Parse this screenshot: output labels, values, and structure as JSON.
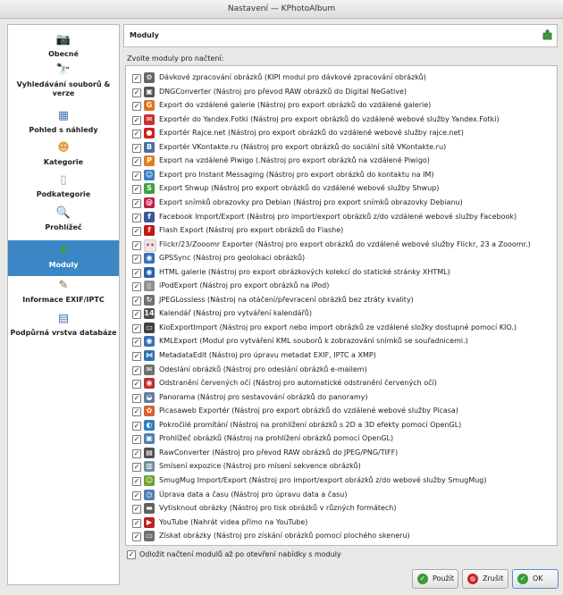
{
  "window": {
    "title": "Nastavení — KPhotoAlbum"
  },
  "sidebar": {
    "items": [
      {
        "label": "Obecné",
        "icon": "camera-icon",
        "glyph": "📷",
        "color": "#444444"
      },
      {
        "label": "Vyhledávání souborů & verze",
        "icon": "binoculars-icon",
        "glyph": "🔭",
        "color": "#555555"
      },
      {
        "label": "Pohled s náhledy",
        "icon": "thumbnails-icon",
        "glyph": "▦",
        "color": "#4a78b8"
      },
      {
        "label": "Kategorie",
        "icon": "user-icon",
        "glyph": "☻",
        "color": "#e0a040"
      },
      {
        "label": "Podkategorie",
        "icon": "document-icon",
        "glyph": "▯",
        "color": "#9aa0a8"
      },
      {
        "label": "Prohlížeč",
        "icon": "magnifier-icon",
        "glyph": "🔍",
        "color": "#3a70b0"
      },
      {
        "label": "Moduly",
        "icon": "plugin-icon",
        "glyph": "✚",
        "color": "#3aa040",
        "active": true
      },
      {
        "label": "Informace EXIF/IPTC",
        "icon": "pen-icon",
        "glyph": "✎",
        "color": "#886633"
      },
      {
        "label": "Podpůrná vrstva databáze",
        "icon": "database-icon",
        "glyph": "▤",
        "color": "#4a78b8"
      }
    ]
  },
  "header": {
    "title": "Moduly",
    "icon": "plugin-icon"
  },
  "plugins": {
    "group_label": "Zvolte moduly pro načtení:",
    "items": [
      {
        "name": "Dávkové zpracování obrázků  (KIPI modul pro dávkové zpracování obrázků)",
        "icon": "batch-icon",
        "glyph": "⚙",
        "color": "#666666",
        "checked": true
      },
      {
        "name": "DNGConverter  (Nástroj pro převod RAW obrázků do Digital NeGative)",
        "icon": "dng-icon",
        "glyph": "▣",
        "color": "#555555",
        "checked": true
      },
      {
        "name": "Export do vzdálené galerie  (Nástroj pro export obrázků do vzdálené galerie)",
        "icon": "gallery-icon",
        "glyph": "G",
        "color": "#e07020",
        "checked": true
      },
      {
        "name": "Exportér do Yandex.Fotki  (Nástroj pro export obrázků do vzdálené webové služby Yandex.Fotki)",
        "icon": "yandex-icon",
        "glyph": "✉",
        "color": "#d03030",
        "checked": true
      },
      {
        "name": "Exportér Rajce.net  (Nástroj pro export obrázků do vzdálené webové služby rajce.net)",
        "icon": "rajce-icon",
        "glyph": "●",
        "color": "#d02020",
        "checked": true
      },
      {
        "name": "Exportér VKontakte.ru  (Nástroj pro export obrázků do sociální sítě VKontakte.ru)",
        "icon": "vkontakte-icon",
        "glyph": "B",
        "color": "#4a6ea0",
        "checked": true
      },
      {
        "name": "Export na vzdálené Piwigo  (.Nástroj pro export obrázků na vzdálené Piwigo)",
        "icon": "piwigo-icon",
        "glyph": "P",
        "color": "#e08020",
        "checked": true
      },
      {
        "name": "Export pro Instant Messaging  (Nástroj pro export obrázků do kontaktu na IM)",
        "icon": "im-icon",
        "glyph": "☺",
        "color": "#3a80c0",
        "checked": true
      },
      {
        "name": "Export Shwup  (Nástroj pro export obrázků do vzdálené webové služby Shwup)",
        "icon": "shwup-icon",
        "glyph": "S",
        "color": "#40a040",
        "checked": true
      },
      {
        "name": "Export snímků obrazovky pro Debian  (Nástroj pro export snímků obrazovky Debianu)",
        "icon": "debian-icon",
        "glyph": "@",
        "color": "#c0204a",
        "checked": true
      },
      {
        "name": "Facebook Import/Export  (Nástroj pro import/export obrázků z/do vzdálené webové služby Facebook)",
        "icon": "facebook-icon",
        "glyph": "f",
        "color": "#3b5998",
        "checked": true
      },
      {
        "name": "Flash Export  (Nástroj pro export obrázků do Flashe)",
        "icon": "flash-icon",
        "glyph": "f",
        "color": "#c01818",
        "checked": true
      },
      {
        "name": "Flickr/23/Zooomr Exporter  (Nástroj pro export obrázků do vzdálené webové služby Flickr, 23 a Zooomr.)",
        "icon": "flickr-icon",
        "glyph": "••",
        "color": "#e8e8e8",
        "checked": true
      },
      {
        "name": "GPSSync  (Nástroj pro geolokaci obrázků)",
        "icon": "globe-icon",
        "glyph": "◉",
        "color": "#3a70b8",
        "checked": true
      },
      {
        "name": "HTML galerie  (Nástroj pro export obrázkových kolekcí do statické stránky XHTML)",
        "icon": "html-globe-icon",
        "glyph": "◉",
        "color": "#2a60a8",
        "checked": true
      },
      {
        "name": "iPodExport  (Nástroj pro export obrázků na iPod)",
        "icon": "ipod-icon",
        "glyph": "▯",
        "color": "#909090",
        "checked": true
      },
      {
        "name": "JPEGLossless  (Nástroj na otáčení/převracení obrázků bez ztráty kvality)",
        "icon": "rotate-icon",
        "glyph": "↻",
        "color": "#707070",
        "checked": true
      },
      {
        "name": "Kalendář  (Nástroj pro vytváření kalendářů)",
        "icon": "calendar-icon",
        "glyph": "14",
        "color": "#505050",
        "checked": true
      },
      {
        "name": "KioExportImport  (Nástroj pro export nebo import obrázků ze vzdálené složky dostupné pomocí KIO.)",
        "icon": "kio-icon",
        "glyph": "▭",
        "color": "#404040",
        "checked": true
      },
      {
        "name": "KMLExport  (Modul pro vytváření KML souborů k zobrazování snímků se souřadnicemi.)",
        "icon": "kml-icon",
        "glyph": "◉",
        "color": "#3a70b8",
        "checked": true
      },
      {
        "name": "MetadataEdit  (Nástroj pro úpravu metadat EXIF, IPTC a XMP)",
        "icon": "metadata-icon",
        "glyph": "⋈",
        "color": "#3070b0",
        "checked": true
      },
      {
        "name": "Odeslání obrázků  (Nástroj pro odeslání obrázků e-mailem)",
        "icon": "mail-icon",
        "glyph": "✉",
        "color": "#707070",
        "checked": true
      },
      {
        "name": "Odstranění červených očí  (Nástroj pro automatické odstranění červených očí)",
        "icon": "redeye-icon",
        "glyph": "◉",
        "color": "#c03030",
        "checked": true
      },
      {
        "name": "Panorama  (Nástroj pro sestavování obrázků do panoramy)",
        "icon": "panorama-icon",
        "glyph": "◒",
        "color": "#6080a0",
        "checked": true
      },
      {
        "name": "Picasaweb Exportér  (Nástroj pro export obrázků do vzdálené webové služby Picasa)",
        "icon": "picasa-icon",
        "glyph": "✿",
        "color": "#e06030",
        "checked": true
      },
      {
        "name": "Pokročilé promítání  (Nástroj na prohlížení obrázků s 2D a 3D efekty pomocí OpenGL)",
        "icon": "slideshow-icon",
        "glyph": "◐",
        "color": "#3080c0",
        "checked": true
      },
      {
        "name": "Prohlížeč obrázků  (Nástroj na prohlížení obrázků pomocí OpenGL)",
        "icon": "viewer-icon",
        "glyph": "▣",
        "color": "#5080b0",
        "checked": true
      },
      {
        "name": "RawConverter  (Nástroj pro převod RAW obrázků do JPEG/PNG/TIFF)",
        "icon": "raw-icon",
        "glyph": "▤",
        "color": "#505050",
        "checked": true
      },
      {
        "name": "Smísení expozice  (Nástroj pro mísení sekvence obrázků)",
        "icon": "blend-icon",
        "glyph": "▥",
        "color": "#7090a0",
        "checked": true
      },
      {
        "name": "SmugMug Import/Export  (Nástroj pro import/export obrázků z/do webové služby SmugMug)",
        "icon": "smugmug-icon",
        "glyph": "☺",
        "color": "#70a030",
        "checked": true
      },
      {
        "name": "Úprava data a času  (Nástroj pro úpravu data a času)",
        "icon": "clock-icon",
        "glyph": "◷",
        "color": "#5080b0",
        "checked": true
      },
      {
        "name": "Vytisknout obrázky  (Nástroj pro tisk obrázků v různých formátech)",
        "icon": "print-icon",
        "glyph": "▬",
        "color": "#606060",
        "checked": true
      },
      {
        "name": "YouTube  (Nahrát videa přímo na YouTube)",
        "icon": "youtube-icon",
        "glyph": "▶",
        "color": "#c02020",
        "checked": true
      },
      {
        "name": "Získat obrázky  (Nástroj pro získání obrázků pomocí plochého skeneru)",
        "icon": "scanner-icon",
        "glyph": "▭",
        "color": "#707070",
        "checked": true
      }
    ]
  },
  "delay": {
    "label": "Odložit načtení modulů až po otevření nabídky s moduly",
    "checked": true
  },
  "buttons": {
    "apply": {
      "label": "Použít",
      "icon": "apply-check-icon",
      "color": "#3a9a3a"
    },
    "cancel": {
      "label": "Zrušit",
      "icon": "cancel-icon",
      "color": "#cc2222"
    },
    "ok": {
      "label": "OK",
      "icon": "ok-check-icon",
      "color": "#3a9a3a"
    }
  },
  "check_glyph": "✓"
}
